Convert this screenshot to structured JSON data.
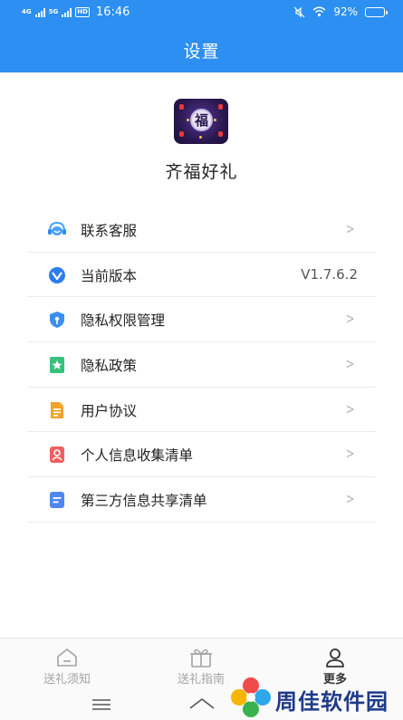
{
  "status_bar": {
    "net1": "4G",
    "net2": "5G",
    "hd": "HD",
    "time": "16:46",
    "battery_percent": "92%",
    "battery_level": 0.92
  },
  "header": {
    "title": "设置"
  },
  "app": {
    "name": "齐福好礼",
    "logo_char": "福"
  },
  "menu": {
    "items": [
      {
        "label": "联系客服",
        "icon": "customer-service-icon",
        "chevron": ">"
      },
      {
        "label": "当前版本",
        "icon": "version-icon",
        "value": "V1.7.6.2"
      },
      {
        "label": "隐私权限管理",
        "icon": "shield-icon",
        "chevron": ">"
      },
      {
        "label": "隐私政策",
        "icon": "bookmark-star-icon",
        "chevron": ">"
      },
      {
        "label": "用户协议",
        "icon": "document-icon",
        "chevron": ">"
      },
      {
        "label": "个人信息收集清单",
        "icon": "person-card-icon",
        "chevron": ">"
      },
      {
        "label": "第三方信息共享清单",
        "icon": "list-icon",
        "chevron": ">"
      }
    ]
  },
  "bottom_nav": {
    "tabs": [
      {
        "label": "送礼须知",
        "icon": "home-icon",
        "active": false
      },
      {
        "label": "送礼指南",
        "icon": "gift-icon",
        "active": false
      },
      {
        "label": "更多",
        "icon": "user-icon",
        "active": true
      }
    ]
  },
  "watermark": {
    "text": "周佳软件园"
  },
  "colors": {
    "primary": "#2c8ff1",
    "text": "#222222",
    "muted": "#a3a3a3",
    "divider": "#ececec"
  }
}
